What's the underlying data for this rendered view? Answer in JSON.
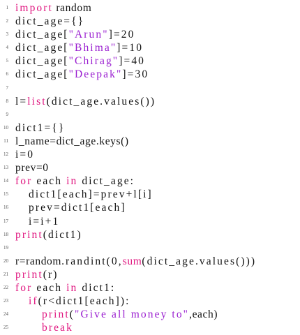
{
  "colors": {
    "keyword": "#e0157f",
    "string": "#9a1ed0",
    "text": "#111111"
  },
  "lines": [
    {
      "n": "1",
      "indent": 0,
      "tokens": [
        {
          "t": "import",
          "c": "kw"
        },
        {
          "t": " random",
          "c": "id"
        }
      ]
    },
    {
      "n": "2",
      "indent": 0,
      "tokens": [
        {
          "t": "dict_age={}",
          "c": ""
        }
      ]
    },
    {
      "n": "3",
      "indent": 0,
      "tokens": [
        {
          "t": "dict_age[",
          "c": ""
        },
        {
          "t": "\"Arun\"",
          "c": "str"
        },
        {
          "t": "]=20",
          "c": ""
        }
      ]
    },
    {
      "n": "4",
      "indent": 0,
      "tokens": [
        {
          "t": "dict_age[",
          "c": ""
        },
        {
          "t": "\"Bhima\"",
          "c": "str"
        },
        {
          "t": "]=10",
          "c": ""
        }
      ]
    },
    {
      "n": "5",
      "indent": 0,
      "tokens": [
        {
          "t": "dict_age[",
          "c": ""
        },
        {
          "t": "\"Chirag\"",
          "c": "str"
        },
        {
          "t": "]=40",
          "c": ""
        }
      ]
    },
    {
      "n": "6",
      "indent": 0,
      "tokens": [
        {
          "t": "dict_age[",
          "c": ""
        },
        {
          "t": "\"Deepak\"",
          "c": "str"
        },
        {
          "t": "]=30",
          "c": ""
        }
      ]
    },
    {
      "n": "7",
      "indent": 0,
      "tokens": []
    },
    {
      "n": "8",
      "indent": 0,
      "tokens": [
        {
          "t": "l=",
          "c": ""
        },
        {
          "t": "list",
          "c": "kw"
        },
        {
          "t": "(dict_age.values())",
          "c": ""
        }
      ]
    },
    {
      "n": "9",
      "indent": 0,
      "tokens": []
    },
    {
      "n": "10",
      "indent": 0,
      "tokens": [
        {
          "t": "dict1={}",
          "c": ""
        }
      ]
    },
    {
      "n": "11",
      "indent": 0,
      "tokens": [
        {
          "t": "l_name=dict_age.keys()",
          "c": "id"
        }
      ]
    },
    {
      "n": "12",
      "indent": 0,
      "tokens": [
        {
          "t": "i=0",
          "c": ""
        }
      ]
    },
    {
      "n": "13",
      "indent": 0,
      "tokens": [
        {
          "t": "prev=0",
          "c": "id"
        }
      ]
    },
    {
      "n": "14",
      "indent": 0,
      "tokens": [
        {
          "t": "for",
          "c": "kw"
        },
        {
          "t": " each ",
          "c": ""
        },
        {
          "t": "in",
          "c": "kw"
        },
        {
          "t": " dict_age:",
          "c": ""
        }
      ]
    },
    {
      "n": "15",
      "indent": 1,
      "tokens": [
        {
          "t": "dict1[each]=prev+l[i]",
          "c": ""
        }
      ]
    },
    {
      "n": "16",
      "indent": 1,
      "tokens": [
        {
          "t": "prev=dict1[each]",
          "c": ""
        }
      ]
    },
    {
      "n": "17",
      "indent": 1,
      "tokens": [
        {
          "t": "i=i+1",
          "c": ""
        }
      ]
    },
    {
      "n": "18",
      "indent": 0,
      "tokens": [
        {
          "t": "print",
          "c": "kw"
        },
        {
          "t": "(dict1)",
          "c": ""
        }
      ]
    },
    {
      "n": "19",
      "indent": 0,
      "tokens": []
    },
    {
      "n": "20",
      "indent": 0,
      "tokens": [
        {
          "t": "r=random",
          "c": "id"
        },
        {
          "t": ".randint(0,",
          "c": ""
        },
        {
          "t": "sum",
          "c": "kw id"
        },
        {
          "t": "(dict_age.values()))",
          "c": ""
        }
      ]
    },
    {
      "n": "21",
      "indent": 0,
      "tokens": [
        {
          "t": "print",
          "c": "kw"
        },
        {
          "t": "(r)",
          "c": ""
        }
      ]
    },
    {
      "n": "22",
      "indent": 0,
      "tokens": [
        {
          "t": "for",
          "c": "kw"
        },
        {
          "t": " each ",
          "c": ""
        },
        {
          "t": "in",
          "c": "kw"
        },
        {
          "t": " dict1:",
          "c": ""
        }
      ]
    },
    {
      "n": "23",
      "indent": 1,
      "tokens": [
        {
          "t": "if",
          "c": "kw"
        },
        {
          "t": "(r<dict1[each]):",
          "c": ""
        }
      ]
    },
    {
      "n": "24",
      "indent": 2,
      "tokens": [
        {
          "t": "print",
          "c": "kw"
        },
        {
          "t": "(",
          "c": ""
        },
        {
          "t": "\"Give all money to\"",
          "c": "str"
        },
        {
          "t": ",each)",
          "c": "id"
        }
      ]
    },
    {
      "n": "25",
      "indent": 2,
      "tokens": [
        {
          "t": "break",
          "c": "kw"
        }
      ]
    }
  ]
}
